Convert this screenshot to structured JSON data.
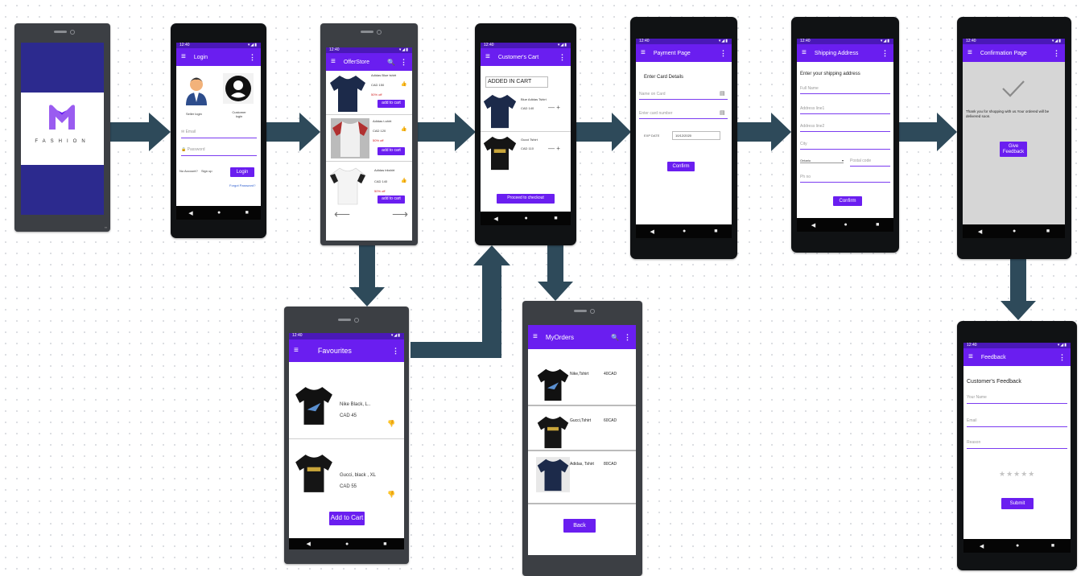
{
  "colors": {
    "primary": "#6a1ef0",
    "status_bar": "#4a18b8",
    "arrow": "#2e4a5a",
    "splash_band": "#2c2a8e"
  },
  "splash": {
    "brand": "FASHION",
    "logo_letter": "M"
  },
  "login": {
    "title": "Login",
    "seller_label": "Seller login",
    "customer_label": "Customer login",
    "email_placeholder": "Email",
    "password_placeholder": "Password",
    "no_account": "No Account?",
    "signup": "Sign up",
    "login_button": "Login",
    "forgot": "Forgot Password?"
  },
  "store": {
    "title": "OfferStore",
    "items": [
      {
        "name": "Adidas Blue tshirt",
        "price": "CAD 150",
        "offer": "50% off",
        "button": "add to cart"
      },
      {
        "name": "Adidas t-shirt",
        "price": "CAD 120",
        "offer": "50% off",
        "button": "add to cart"
      },
      {
        "name": "Adidas trkshirt",
        "price": "CAD 140",
        "offer": "50% off",
        "button": "add to cart"
      }
    ]
  },
  "favourites": {
    "title": "Favourites",
    "items": [
      {
        "name": "Nike Black, L..",
        "price": "CAD 45"
      },
      {
        "name": "Gucci, black , XL",
        "price": "CAD 55"
      }
    ],
    "add_button": "Add to Cart"
  },
  "cart": {
    "title": "Customer's Cart",
    "heading": "ADDED IN CART",
    "items": [
      {
        "name": "Blue Adidas Tshirt",
        "price": "CAD 140"
      },
      {
        "name": "Gucci Tshirt",
        "price": "CAD 110"
      }
    ],
    "checkout_button": "Proceed to checkout"
  },
  "orders": {
    "title": "MyOrders",
    "items": [
      {
        "name": "Nike,Tshirt",
        "price": "40CAD"
      },
      {
        "name": "Gucci,Tshirt",
        "price": "60CAD"
      },
      {
        "name": "Adidas, Tshirt",
        "price": "80CAD"
      }
    ],
    "back_button": "Back"
  },
  "payment": {
    "title": "Payment Page",
    "heading": "Enter Card Details",
    "name_placeholder": "Name on Card",
    "number_placeholder": "Enter card number",
    "expiry_label": "EXP DATE",
    "expiry_value": "10/12/2020",
    "confirm_button": "Confirm"
  },
  "shipping": {
    "title": "Shipping Address",
    "heading": "Enter your shipping address",
    "fields": [
      "Full Name",
      "Address line1",
      "Address line2",
      "City"
    ],
    "province": "Ontario",
    "postal_placeholder": "Postal code",
    "phone_placeholder": "Ph no",
    "confirm_button": "Confirm"
  },
  "confirmation": {
    "title": "Confirmation Page",
    "message": "Thank you for shopping with us.Your ordered will be delivered soon.",
    "feedback_button": "Give Feedback"
  },
  "feedback": {
    "title": "Feedback",
    "heading": "Customer's Feedback",
    "fields": [
      "Your Name",
      "Email",
      "Reason"
    ],
    "stars": "★★★★★",
    "submit_button": "Submit"
  },
  "nav": {
    "back": "◀",
    "home": "●",
    "recent": "■"
  }
}
